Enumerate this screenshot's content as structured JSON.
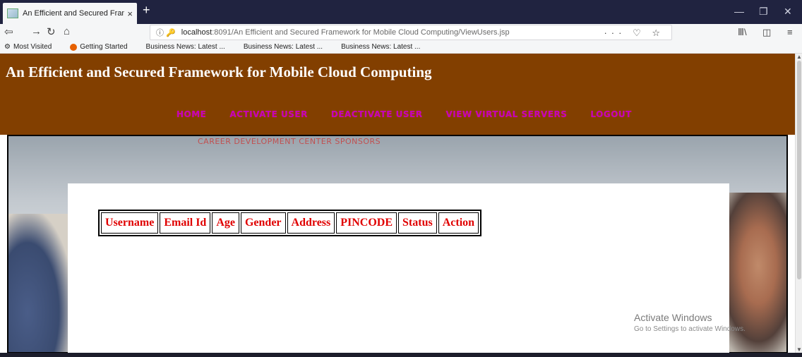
{
  "browser": {
    "tab_title": "An Efficient and Secured Frame",
    "tab_close": "×",
    "new_tab": "+",
    "url_info": "ⓘ 🔑",
    "url_host": "localhost",
    "url_path": ":8091/An Efficient and Secured Framework for Mobile Cloud Computing/ViewUsers.jsp",
    "url_tools": "··· ♡ ☆",
    "bookmarks": [
      "Most Visited",
      "Getting Started",
      "Business News: Latest ...",
      "Business News: Latest ...",
      "Business News: Latest ..."
    ]
  },
  "page": {
    "title": "An Efficient and Secured Framework for Mobile Cloud Computing",
    "menu": [
      "HOME",
      "ACTIVATE USER",
      "DEACTIVATE USER",
      "VIEW VIRTUAL SERVERS",
      "LOGOUT"
    ],
    "background_sign": "CAREER DEVELOPMENT CENTER SPONSORS",
    "table_headers": [
      "Username",
      "Email Id",
      "Age",
      "Gender",
      "Address",
      "PINCODE",
      "Status",
      "Action"
    ]
  },
  "watermark": {
    "title": "Activate Windows",
    "subtitle": "Go to Settings to activate Windows."
  }
}
